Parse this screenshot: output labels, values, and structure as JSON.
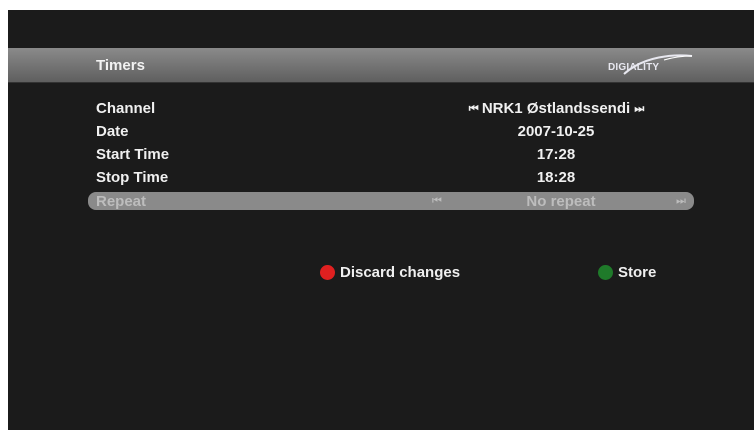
{
  "header": {
    "title": "Timers",
    "logo_text": "DIGIALITY",
    "logo_icon": "digiality-logo-icon"
  },
  "rows": [
    {
      "label": "Channel",
      "value": "NRK1 Østlandssendi",
      "arrows": "true"
    },
    {
      "label": "Date",
      "value": "2007-10-25"
    },
    {
      "label": "Start Time",
      "value": "17:28"
    },
    {
      "label": "Stop Time",
      "value": "18:28"
    },
    {
      "label": "Repeat",
      "value": "No repeat",
      "selected": "true"
    }
  ],
  "arrows": {
    "prev": "⏮",
    "next": "⏭"
  },
  "actions": {
    "discard": {
      "label": "Discard changes",
      "color": "#e02020",
      "icon": "red-button-icon"
    },
    "store": {
      "label": "Store",
      "color": "#1f7a2a",
      "icon": "green-button-icon"
    }
  },
  "colors": {
    "background": "#1b1b1b",
    "title_bar": "#7a7a7a",
    "selected_row": "#8a8a8a"
  }
}
